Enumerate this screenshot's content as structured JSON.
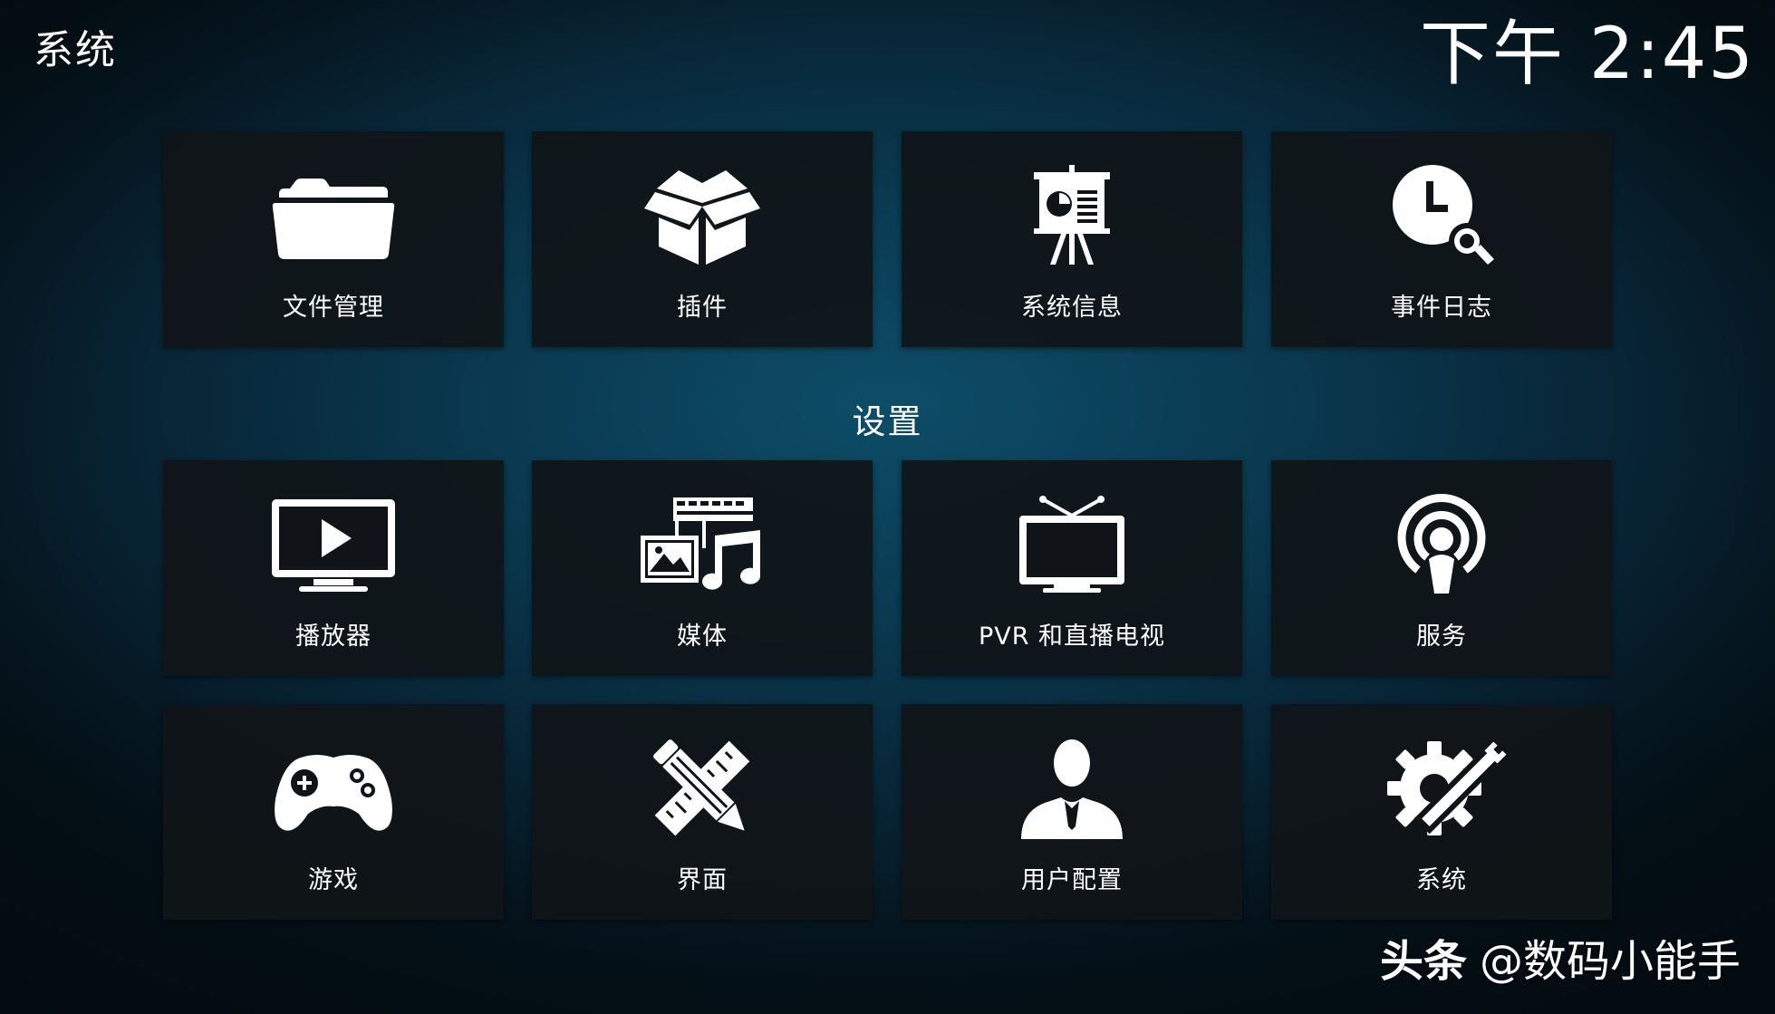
{
  "window": {
    "title": "系统",
    "clock": "下午 2:45"
  },
  "top_row": [
    {
      "label": "文件管理",
      "icon": "folder-icon"
    },
    {
      "label": "插件",
      "icon": "addon-box-icon"
    },
    {
      "label": "系统信息",
      "icon": "presentation-board-icon"
    },
    {
      "label": "事件日志",
      "icon": "clock-search-icon"
    }
  ],
  "settings": {
    "section_title": "设置",
    "items": [
      {
        "label": "播放器",
        "icon": "tv-play-icon"
      },
      {
        "label": "媒体",
        "icon": "media-library-icon"
      },
      {
        "label": "PVR 和直播电视",
        "icon": "antenna-tv-icon"
      },
      {
        "label": "服务",
        "icon": "broadcast-service-icon"
      },
      {
        "label": "游戏",
        "icon": "gamepad-icon"
      },
      {
        "label": "界面",
        "icon": "pencil-ruler-icon"
      },
      {
        "label": "用户配置",
        "icon": "user-profile-icon"
      },
      {
        "label": "系统",
        "icon": "gear-wrench-icon"
      }
    ]
  },
  "watermark": {
    "brand": "头条",
    "handle": "@数码小能手"
  },
  "colors": {
    "background_center": "#0d4d68",
    "background_edge": "#04121a",
    "tile": "#101418",
    "text": "#ffffff"
  }
}
